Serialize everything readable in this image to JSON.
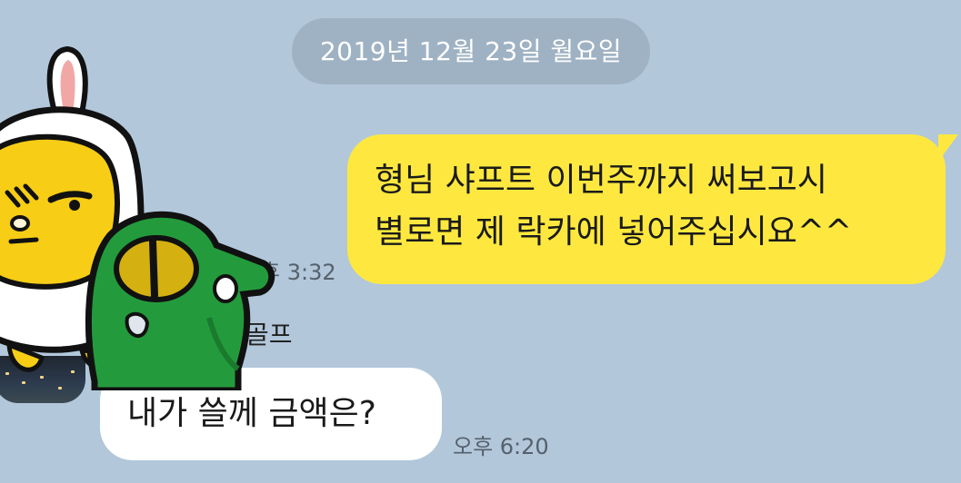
{
  "chat": {
    "date_divider": "2019년 12월 23일 월요일",
    "sent_message": {
      "line1": "형님 샤프트 이번주까지 써보고시",
      "line2": "별로면 제 락카에 넣어주십시요^^",
      "time": "후 3:32"
    },
    "received_message": {
      "sender": "골프",
      "text": "내가 쓸께 금액은?",
      "time": "오후 6:20"
    }
  },
  "colors": {
    "background": "#b2c7da",
    "sent_bubble": "#fee83f",
    "received_bubble": "#ffffff",
    "date_pill": "#9fb2c3"
  },
  "icons": {
    "stickers": "emoticon-sticker-icon"
  }
}
